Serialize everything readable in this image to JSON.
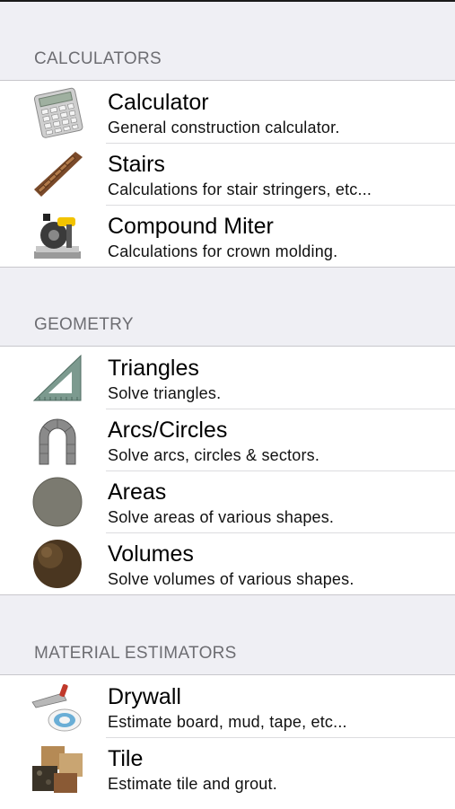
{
  "sections": [
    {
      "header": "CALCULATORS",
      "items": [
        {
          "title": "Calculator",
          "subtitle": "General construction calculator.",
          "icon": "calculator-icon"
        },
        {
          "title": "Stairs",
          "subtitle": "Calculations for stair stringers, etc...",
          "icon": "stairs-icon"
        },
        {
          "title": "Compound Miter",
          "subtitle": "Calculations for crown molding.",
          "icon": "miter-saw-icon"
        }
      ]
    },
    {
      "header": "GEOMETRY",
      "items": [
        {
          "title": "Triangles",
          "subtitle": "Solve triangles.",
          "icon": "triangle-square-icon"
        },
        {
          "title": "Arcs/Circles",
          "subtitle": "Solve arcs, circles & sectors.",
          "icon": "stone-arch-icon"
        },
        {
          "title": "Areas",
          "subtitle": "Solve areas of various shapes.",
          "icon": "area-disc-icon"
        },
        {
          "title": "Volumes",
          "subtitle": "Solve volumes of various shapes.",
          "icon": "volume-sphere-icon"
        }
      ]
    },
    {
      "header": "MATERIAL ESTIMATORS",
      "items": [
        {
          "title": "Drywall",
          "subtitle": "Estimate board, mud, tape, etc...",
          "icon": "drywall-tools-icon"
        },
        {
          "title": "Tile",
          "subtitle": "Estimate tile and grout.",
          "icon": "tile-samples-icon"
        }
      ]
    }
  ]
}
